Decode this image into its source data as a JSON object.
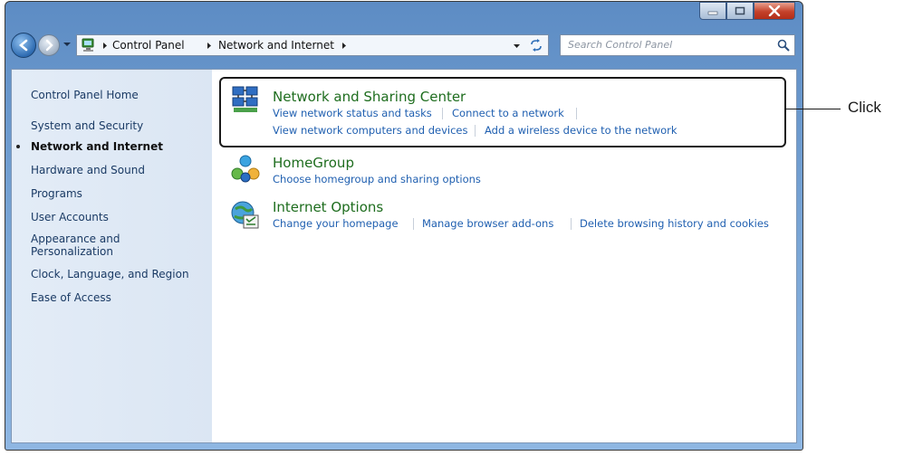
{
  "window": {
    "caption_buttons": [
      {
        "name": "minimize-button",
        "icon": "minimize-icon"
      },
      {
        "name": "maximize-button",
        "icon": "maximize-icon"
      },
      {
        "name": "close-button",
        "icon": "close-icon"
      }
    ]
  },
  "address_bar": {
    "breadcrumbs": [
      "Control Panel",
      "Network and Internet"
    ]
  },
  "search": {
    "placeholder": "Search Control Panel"
  },
  "sidebar": {
    "items": [
      {
        "label": "Control Panel Home",
        "active": false
      },
      {
        "label": "System and Security",
        "active": false
      },
      {
        "label": "Network and Internet",
        "active": true
      },
      {
        "label": "Hardware and Sound",
        "active": false
      },
      {
        "label": "Programs",
        "active": false
      },
      {
        "label": "User Accounts",
        "active": false
      },
      {
        "label": "Appearance and Personalization",
        "active": false
      },
      {
        "label": "Clock, Language, and Region",
        "active": false
      },
      {
        "label": "Ease of Access",
        "active": false
      }
    ]
  },
  "categories": [
    {
      "title": "Network and Sharing Center",
      "icon": "network-sharing-center-icon",
      "links": [
        [
          "View network status and tasks",
          "Connect to a network"
        ],
        [
          "View network computers and devices",
          "Add a wireless device to the network"
        ]
      ]
    },
    {
      "title": "HomeGroup",
      "icon": "homegroup-icon",
      "links": [
        [
          "Choose homegroup and sharing options"
        ]
      ]
    },
    {
      "title": "Internet Options",
      "icon": "internet-options-icon",
      "links": [
        [
          "Change your homepage",
          "Manage browser add-ons",
          "Delete browsing history and cookies"
        ]
      ]
    }
  ],
  "annotation": {
    "label": "Click"
  }
}
